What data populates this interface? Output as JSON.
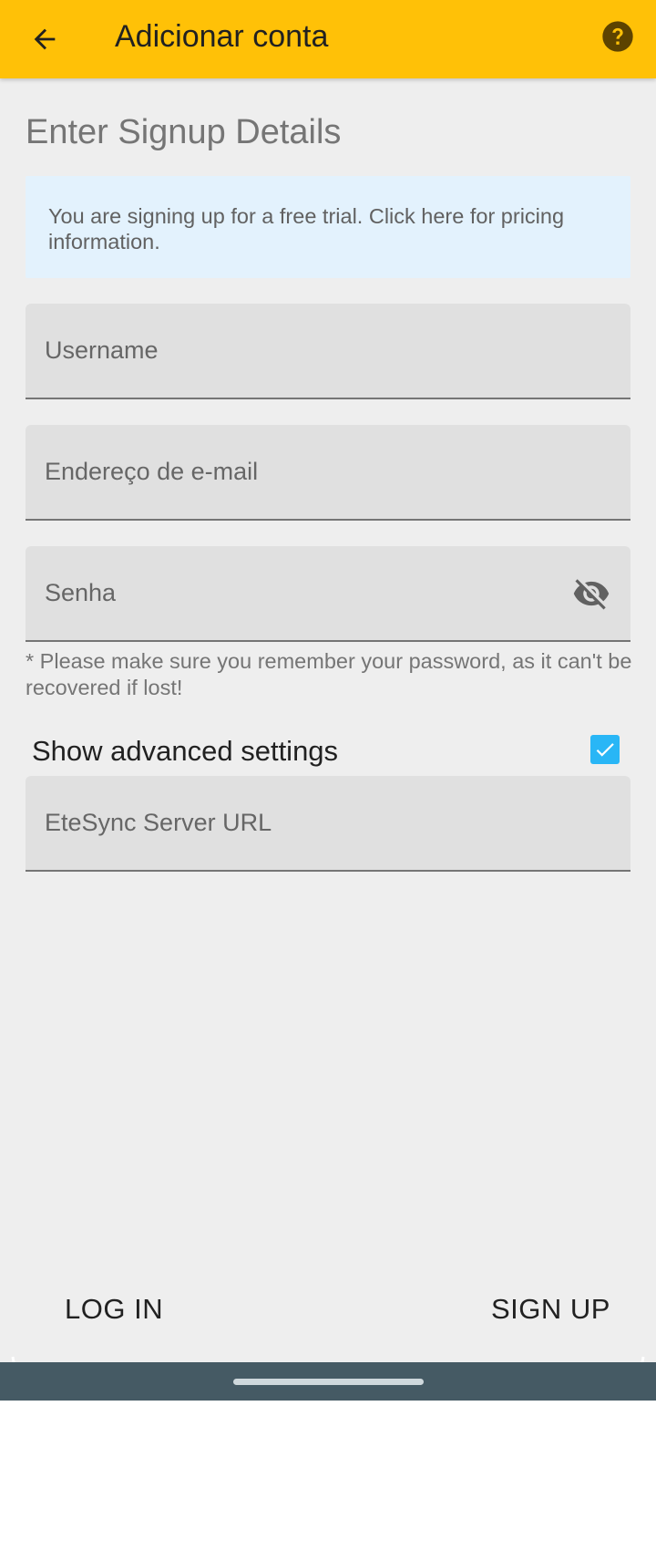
{
  "appbar": {
    "title": "Adicionar conta"
  },
  "form": {
    "section_title": "Enter Signup Details",
    "info_text": "You are signing up for a free trial. Click here for pricing information.",
    "username_placeholder": "Username",
    "email_placeholder": "Endereço de e-mail",
    "password_placeholder": "Senha",
    "password_helper": "* Please make sure you remember your password, as it can't be recovered if lost!",
    "advanced_label": "Show advanced settings",
    "advanced_checked": true,
    "server_url_placeholder": "EteSync Server URL"
  },
  "actions": {
    "login_label": "LOG IN",
    "signup_label": "SIGN UP"
  },
  "icons": {
    "back": "arrow-back-icon",
    "help": "help-circle-icon",
    "visibility": "visibility-off-icon",
    "checkbox": "checkmark-icon"
  },
  "colors": {
    "appbar": "#ffc107",
    "info_background": "#e3f2fd",
    "checkbox": "#29b6f6",
    "navbar": "#455a64"
  }
}
